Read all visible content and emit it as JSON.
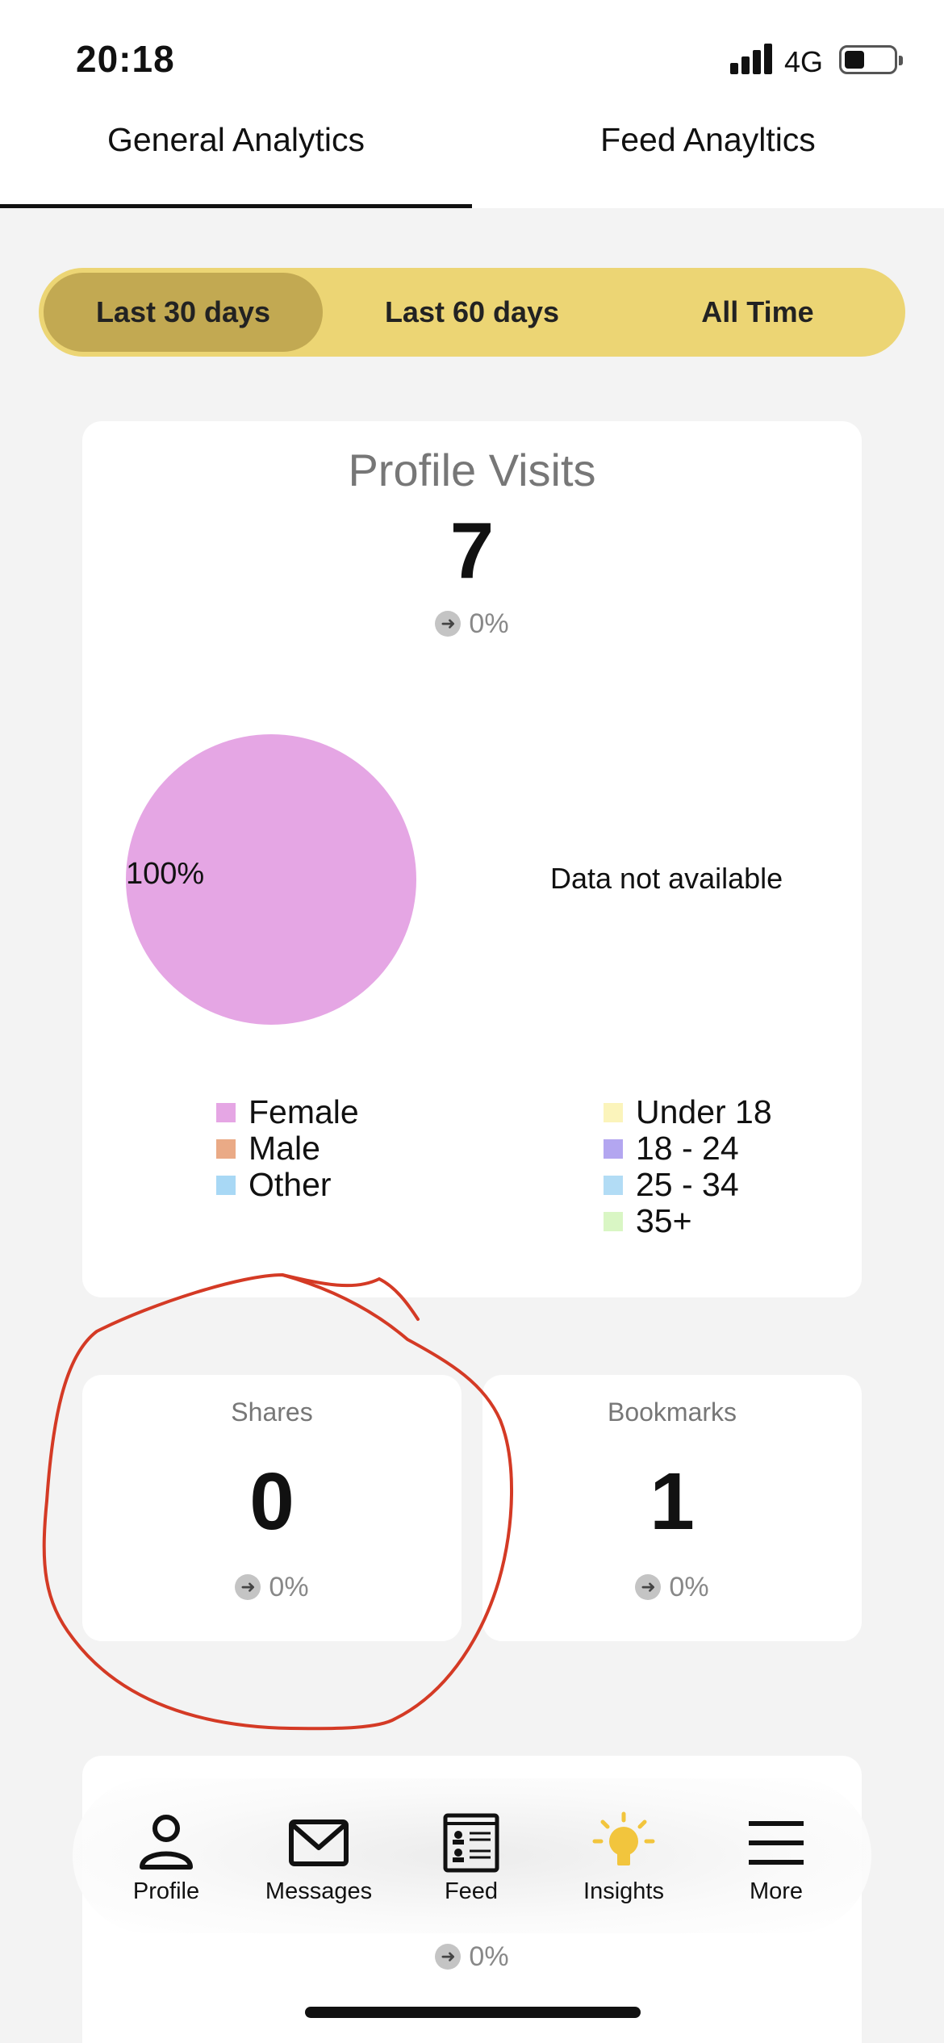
{
  "status_bar": {
    "time": "20:18",
    "network": "4G",
    "icons": [
      "signal-icon",
      "battery-icon"
    ]
  },
  "top_tabs": [
    {
      "label": "General Analytics",
      "active": true
    },
    {
      "label": "Feed Anayltics",
      "active": false
    }
  ],
  "range_selector": {
    "options": [
      "Last 30 days",
      "Last 60 days",
      "All Time"
    ],
    "selected": "Last 30 days"
  },
  "profile_visits": {
    "title": "Profile Visits",
    "value": "7",
    "change": "0%",
    "gender_chart": {
      "slices": [
        {
          "label": "Female",
          "percent": 100,
          "color": "#e5a6e4"
        }
      ],
      "label": "100%"
    },
    "age_chart_message": "Data not available",
    "gender_legend": [
      {
        "label": "Female",
        "color": "#e5a6e4"
      },
      {
        "label": "Male",
        "color": "#eaaa86"
      },
      {
        "label": "Other",
        "color": "#a8d8f5"
      }
    ],
    "age_legend": [
      {
        "label": "Under 18",
        "color": "#fbf4bb"
      },
      {
        "label": "18 - 24",
        "color": "#b3a6f0"
      },
      {
        "label": "25 - 34",
        "color": "#b2dcf5"
      },
      {
        "label": "35+",
        "color": "#d9f6c4"
      }
    ]
  },
  "shares": {
    "title": "Shares",
    "value": "0",
    "change": "0%"
  },
  "bookmarks": {
    "title": "Bookmarks",
    "value": "1",
    "change": "0%"
  },
  "bottom_card": {
    "change": "0%"
  },
  "tab_bar": [
    {
      "label": "Profile",
      "icon": "profile-icon"
    },
    {
      "label": "Messages",
      "icon": "messages-icon"
    },
    {
      "label": "Feed",
      "icon": "feed-icon"
    },
    {
      "label": "Insights",
      "icon": "insights-icon",
      "color": "#f2c53d"
    },
    {
      "label": "More",
      "icon": "more-icon"
    }
  ],
  "colors": {
    "segment_bg": "#ecd574",
    "segment_active": "#c2a952",
    "annotation": "#d43a25"
  }
}
